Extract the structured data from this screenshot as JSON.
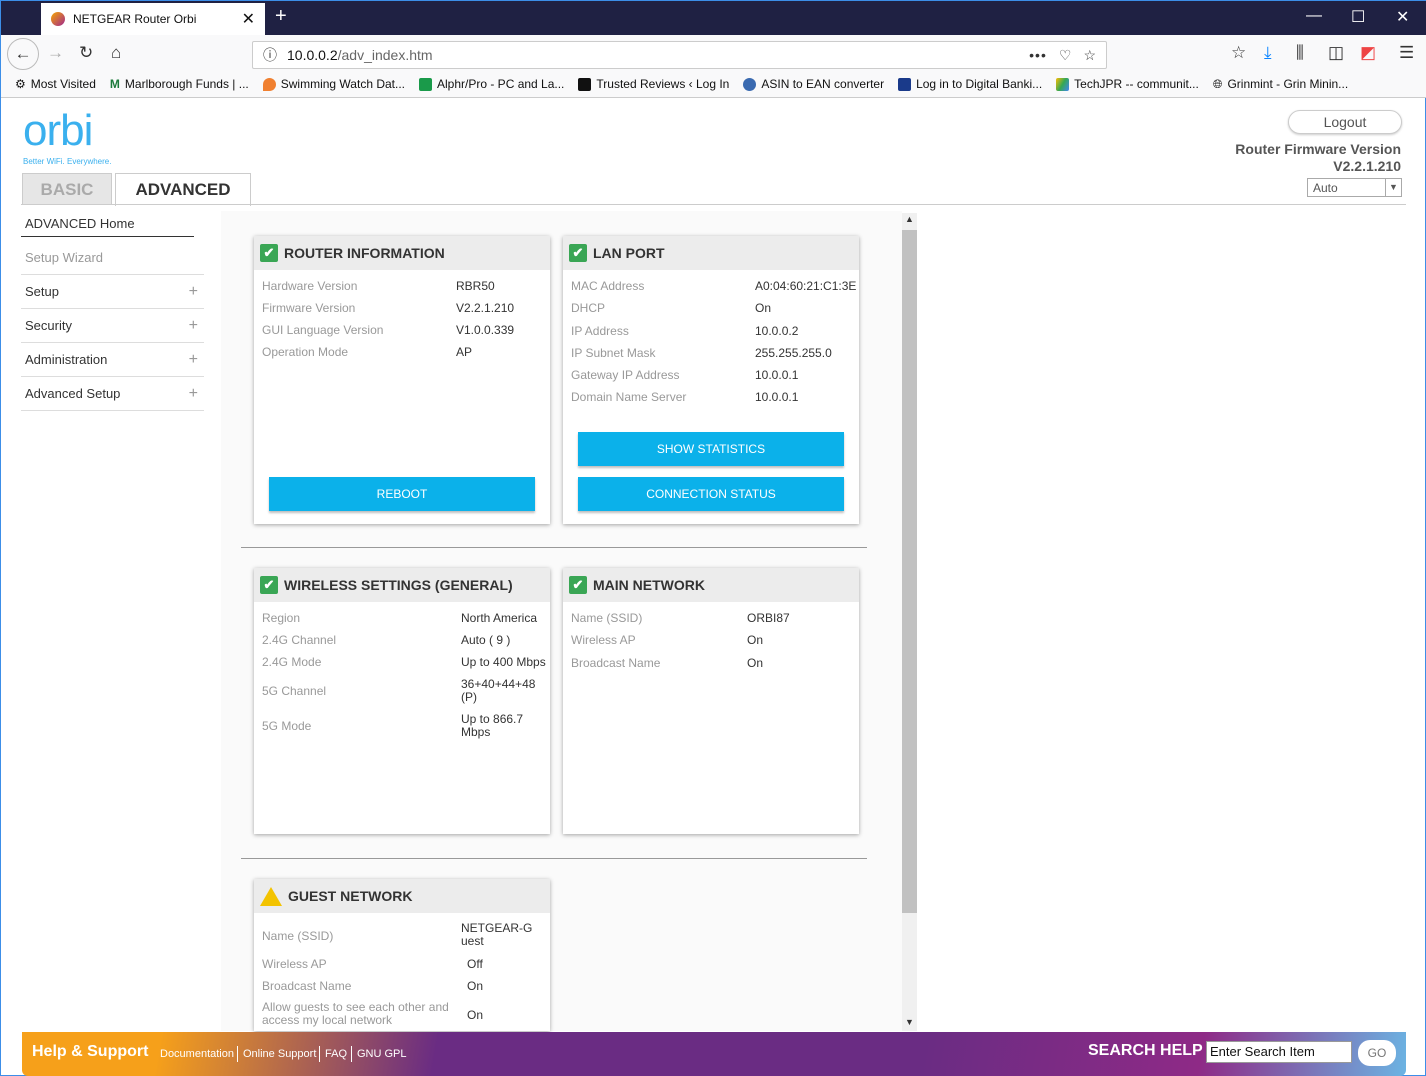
{
  "browser": {
    "tab_title": "NETGEAR Router Orbi",
    "url_host": "10.0.0.2",
    "url_path": "/adv_index.htm",
    "bookmarks": [
      "Most Visited",
      "Marlborough Funds | ...",
      "Swimming Watch Dat...",
      "Alphr/Pro - PC and La...",
      "Trusted Reviews ‹ Log In",
      "ASIN to EAN converter",
      "Log in to Digital Banki...",
      "TechJPR -- communit...",
      "Grinmint - Grin Minin..."
    ]
  },
  "header": {
    "logo": "orbi",
    "tagline": "Better WiFi. Everywhere.",
    "tab_basic": "BASIC",
    "tab_advanced": "ADVANCED",
    "logout": "Logout",
    "fw_label": "Router Firmware Version",
    "fw_version": "V2.2.1.210",
    "language": "Auto"
  },
  "sidebar": [
    {
      "label": "ADVANCED Home"
    },
    {
      "label": "Setup Wizard"
    },
    {
      "label": "Setup"
    },
    {
      "label": "Security"
    },
    {
      "label": "Administration"
    },
    {
      "label": "Advanced Setup"
    }
  ],
  "router_info": {
    "title": "ROUTER INFORMATION",
    "rows": [
      [
        "Hardware Version",
        "RBR50"
      ],
      [
        "Firmware Version",
        "V2.2.1.210"
      ],
      [
        "GUI Language Version",
        "V1.0.0.339"
      ],
      [
        "Operation Mode",
        "AP"
      ]
    ],
    "reboot": "REBOOT"
  },
  "lan_port": {
    "title": "LAN PORT",
    "rows": [
      [
        "MAC Address",
        "A0:04:60:21:C1:3E"
      ],
      [
        "DHCP",
        "On"
      ],
      [
        "IP Address",
        "10.0.0.2"
      ],
      [
        "IP Subnet Mask",
        "255.255.255.0"
      ],
      [
        "Gateway IP Address",
        "10.0.0.1"
      ],
      [
        "Domain Name Server",
        "10.0.0.1"
      ]
    ],
    "show_stats": "SHOW STATISTICS",
    "conn_status": "CONNECTION STATUS"
  },
  "wireless": {
    "title": "WIRELESS SETTINGS (GENERAL)",
    "rows": [
      [
        "Region",
        "North America"
      ],
      [
        "2.4G Channel",
        "Auto ( 9 )"
      ],
      [
        "2.4G Mode",
        "Up to 400 Mbps"
      ],
      [
        "5G Channel",
        "36+40+44+48(P)"
      ],
      [
        "5G Mode",
        "Up to 866.7 Mbps"
      ]
    ]
  },
  "main_network": {
    "title": "MAIN NETWORK",
    "rows": [
      [
        "Name (SSID)",
        "ORBI87"
      ],
      [
        "Wireless AP",
        "On"
      ],
      [
        "Broadcast Name",
        "On"
      ]
    ]
  },
  "guest_network": {
    "title": "GUEST NETWORK",
    "rows": [
      [
        "Name (SSID)",
        "NETGEAR-Guest"
      ],
      [
        "Wireless AP",
        "Off"
      ],
      [
        "Broadcast Name",
        "On"
      ],
      [
        "Allow guests to see each other and access my local network",
        "On"
      ]
    ]
  },
  "footer": {
    "help": "Help & Support",
    "links": [
      "Documentation",
      "Online Support",
      "FAQ",
      "GNU GPL"
    ],
    "search_label": "SEARCH HELP",
    "search_placeholder": "Enter Search Item",
    "go": "GO"
  }
}
